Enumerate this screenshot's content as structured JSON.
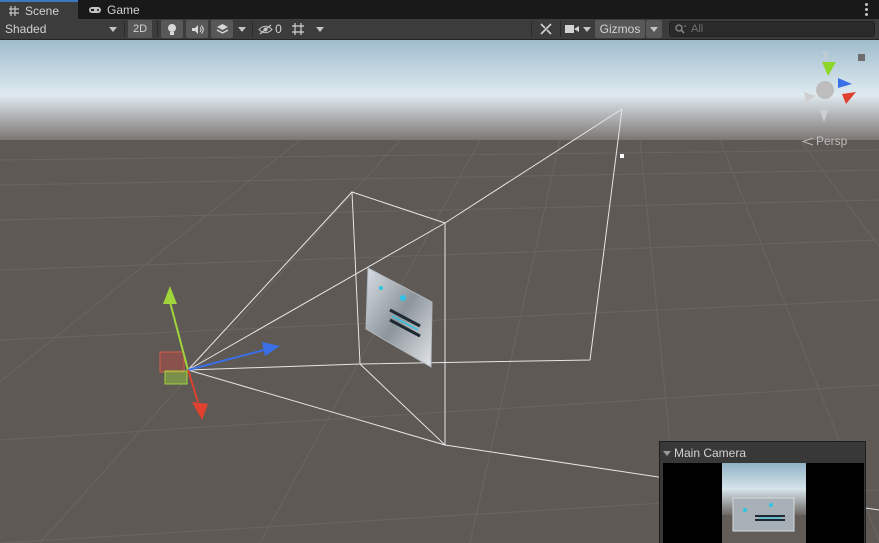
{
  "tabs": [
    {
      "label": "Scene",
      "icon": "grid-icon",
      "active": true
    },
    {
      "label": "Game",
      "icon": "gamepad-icon",
      "active": false
    }
  ],
  "toolbar": {
    "shading_mode": "Shaded",
    "mode_2d": "2D",
    "hidden_count": "0",
    "gizmos_label": "Gizmos",
    "search_placeholder": "All"
  },
  "scene": {
    "projection_label": "Persp",
    "gizmo_axis_label": "y",
    "axis_colors": {
      "x": "#e0402e",
      "y": "#8fd62b",
      "z": "#3a6fe8"
    },
    "sky_color": "#c9dbe6",
    "ground_color": "#5f5955"
  },
  "camera_preview": {
    "title": "Main Camera"
  }
}
